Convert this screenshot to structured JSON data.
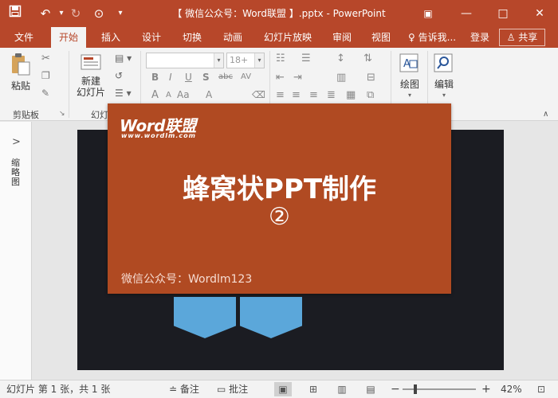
{
  "titlebar": {
    "doc_title": "【 微信公众号：Word联盟 】.pptx - PowerPoint",
    "save_icon": "save-icon",
    "undo_icon": "undo-icon",
    "redo_icon": "redo-icon",
    "minimize": "—",
    "restore": "□",
    "close": "✕",
    "ribbon_options": "▣"
  },
  "tabs": {
    "file": "文件",
    "home": "开始",
    "insert": "插入",
    "design": "设计",
    "transitions": "切换",
    "animations": "动画",
    "slideshow": "幻灯片放映",
    "review": "审阅",
    "view": "视图",
    "tell_me": "告诉我...",
    "signin": "登录",
    "share": "共享"
  },
  "ribbon": {
    "paste_label": "粘贴",
    "clipboard_group": "剪贴板",
    "new_slide_label_1": "新建",
    "new_slide_label_2": "幻灯片",
    "slides_group": "幻灯",
    "font_name_value": "",
    "font_size_value": "18+",
    "bold": "B",
    "italic": "I",
    "underline": "U",
    "shadow": "S",
    "strike": "abc",
    "spacing": "AV",
    "fontsize_up": "A",
    "fontsize_down": "A",
    "case": "Aa",
    "color": "A",
    "drawing_label": "绘图",
    "editing_label": "编辑"
  },
  "slide_pane": {
    "expand_icon": ">",
    "label": "缩略图"
  },
  "card": {
    "logo": "Word联盟",
    "logo_sub": "www.wordlm.com",
    "title": "蜂窝状PPT制作",
    "number": "②",
    "footer": "微信公众号：Wordlm123"
  },
  "status": {
    "slide_info": "幻灯片 第 1 张，共 1 张",
    "notes": "备注",
    "comments": "批注",
    "zoom_level": 42,
    "zoom_text": "42%",
    "zoom_minus": "−",
    "zoom_plus": "+"
  },
  "colors": {
    "accent": "#b7472a",
    "card": "#b04a22",
    "slide_bg": "#1b1c22",
    "hex_blue": "#5ba7da"
  }
}
